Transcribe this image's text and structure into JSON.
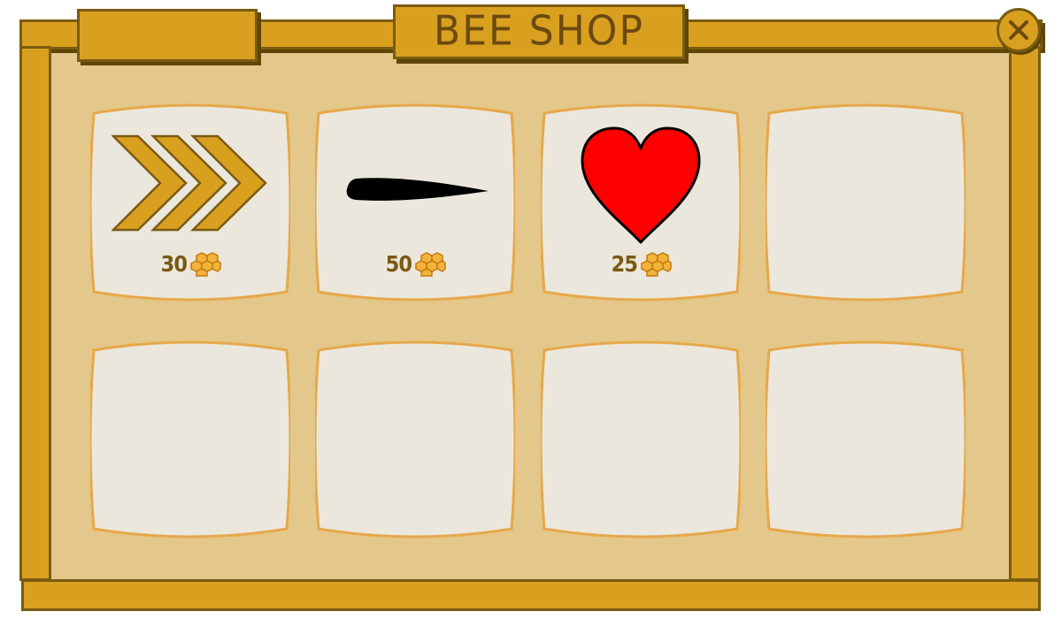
{
  "title": "BEE SHOP",
  "close_icon": "close-icon",
  "colors": {
    "frame": "#d9a020",
    "frame_border": "#7a5c10",
    "panel": "#e4c78a",
    "card": "#ebe7dc",
    "card_border": "#e6a84a",
    "price_text": "#7a5a14"
  },
  "items": [
    {
      "icon": "speed-chevrons-icon",
      "price": "30",
      "currency_icon": "honeycomb-icon"
    },
    {
      "icon": "stinger-icon",
      "price": "50",
      "currency_icon": "honeycomb-icon"
    },
    {
      "icon": "heart-icon",
      "price": "25",
      "currency_icon": "honeycomb-icon"
    },
    {
      "icon": null,
      "price": null
    },
    {
      "icon": null,
      "price": null
    },
    {
      "icon": null,
      "price": null
    },
    {
      "icon": null,
      "price": null
    },
    {
      "icon": null,
      "price": null
    }
  ]
}
